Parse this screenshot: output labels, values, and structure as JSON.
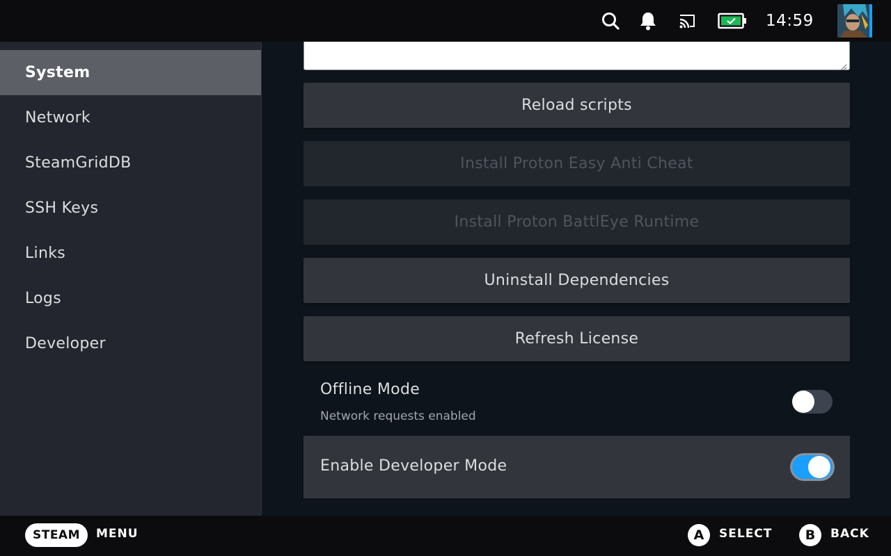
{
  "topbar": {
    "clock": "14:59",
    "icons": [
      "search-icon",
      "notification-bell-icon",
      "cast-icon",
      "battery-icon"
    ],
    "battery_color": "#1db954"
  },
  "sidebar": {
    "items": [
      {
        "label": "System",
        "active": true
      },
      {
        "label": "Network",
        "active": false
      },
      {
        "label": "SteamGridDB",
        "active": false
      },
      {
        "label": "SSH Keys",
        "active": false
      },
      {
        "label": "Links",
        "active": false
      },
      {
        "label": "Logs",
        "active": false
      },
      {
        "label": "Developer",
        "active": false
      }
    ]
  },
  "main": {
    "textarea_value": "",
    "buttons": [
      {
        "label": "Reload scripts",
        "enabled": true
      },
      {
        "label": "Install Proton Easy Anti Cheat",
        "enabled": false
      },
      {
        "label": "Install Proton BattlEye Runtime",
        "enabled": false
      },
      {
        "label": "Uninstall Dependencies",
        "enabled": true
      },
      {
        "label": "Refresh License",
        "enabled": true
      }
    ],
    "offline_mode": {
      "label": "Offline Mode",
      "description": "Network requests enabled",
      "enabled": false
    },
    "developer_mode": {
      "label": "Enable Developer Mode",
      "enabled": true
    }
  },
  "bottombar": {
    "steam_label": "STEAM",
    "menu_label": "MENU",
    "a_glyph": "A",
    "select_label": "SELECT",
    "b_glyph": "B",
    "back_label": "BACK"
  },
  "colors": {
    "accent": "#1a9fff",
    "sidebar_bg": "#23262e",
    "active_item_bg": "#5c5f66",
    "button_bg": "#32353c",
    "content_bg": "#0e141b"
  }
}
